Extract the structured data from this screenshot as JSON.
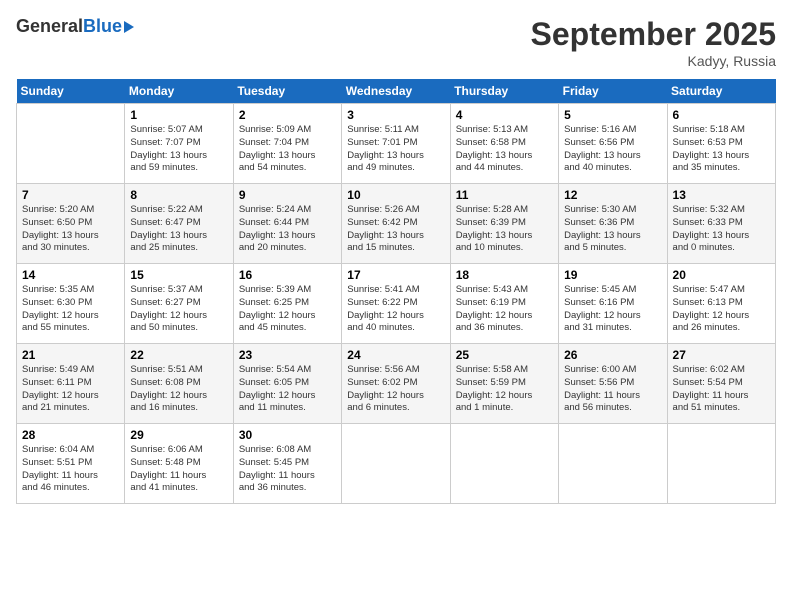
{
  "header": {
    "logo_general": "General",
    "logo_blue": "Blue",
    "month_title": "September 2025",
    "location": "Kadyy, Russia"
  },
  "weekdays": [
    "Sunday",
    "Monday",
    "Tuesday",
    "Wednesday",
    "Thursday",
    "Friday",
    "Saturday"
  ],
  "weeks": [
    [
      {
        "day": "",
        "info": ""
      },
      {
        "day": "1",
        "info": "Sunrise: 5:07 AM\nSunset: 7:07 PM\nDaylight: 13 hours\nand 59 minutes."
      },
      {
        "day": "2",
        "info": "Sunrise: 5:09 AM\nSunset: 7:04 PM\nDaylight: 13 hours\nand 54 minutes."
      },
      {
        "day": "3",
        "info": "Sunrise: 5:11 AM\nSunset: 7:01 PM\nDaylight: 13 hours\nand 49 minutes."
      },
      {
        "day": "4",
        "info": "Sunrise: 5:13 AM\nSunset: 6:58 PM\nDaylight: 13 hours\nand 44 minutes."
      },
      {
        "day": "5",
        "info": "Sunrise: 5:16 AM\nSunset: 6:56 PM\nDaylight: 13 hours\nand 40 minutes."
      },
      {
        "day": "6",
        "info": "Sunrise: 5:18 AM\nSunset: 6:53 PM\nDaylight: 13 hours\nand 35 minutes."
      }
    ],
    [
      {
        "day": "7",
        "info": "Sunrise: 5:20 AM\nSunset: 6:50 PM\nDaylight: 13 hours\nand 30 minutes."
      },
      {
        "day": "8",
        "info": "Sunrise: 5:22 AM\nSunset: 6:47 PM\nDaylight: 13 hours\nand 25 minutes."
      },
      {
        "day": "9",
        "info": "Sunrise: 5:24 AM\nSunset: 6:44 PM\nDaylight: 13 hours\nand 20 minutes."
      },
      {
        "day": "10",
        "info": "Sunrise: 5:26 AM\nSunset: 6:42 PM\nDaylight: 13 hours\nand 15 minutes."
      },
      {
        "day": "11",
        "info": "Sunrise: 5:28 AM\nSunset: 6:39 PM\nDaylight: 13 hours\nand 10 minutes."
      },
      {
        "day": "12",
        "info": "Sunrise: 5:30 AM\nSunset: 6:36 PM\nDaylight: 13 hours\nand 5 minutes."
      },
      {
        "day": "13",
        "info": "Sunrise: 5:32 AM\nSunset: 6:33 PM\nDaylight: 13 hours\nand 0 minutes."
      }
    ],
    [
      {
        "day": "14",
        "info": "Sunrise: 5:35 AM\nSunset: 6:30 PM\nDaylight: 12 hours\nand 55 minutes."
      },
      {
        "day": "15",
        "info": "Sunrise: 5:37 AM\nSunset: 6:27 PM\nDaylight: 12 hours\nand 50 minutes."
      },
      {
        "day": "16",
        "info": "Sunrise: 5:39 AM\nSunset: 6:25 PM\nDaylight: 12 hours\nand 45 minutes."
      },
      {
        "day": "17",
        "info": "Sunrise: 5:41 AM\nSunset: 6:22 PM\nDaylight: 12 hours\nand 40 minutes."
      },
      {
        "day": "18",
        "info": "Sunrise: 5:43 AM\nSunset: 6:19 PM\nDaylight: 12 hours\nand 36 minutes."
      },
      {
        "day": "19",
        "info": "Sunrise: 5:45 AM\nSunset: 6:16 PM\nDaylight: 12 hours\nand 31 minutes."
      },
      {
        "day": "20",
        "info": "Sunrise: 5:47 AM\nSunset: 6:13 PM\nDaylight: 12 hours\nand 26 minutes."
      }
    ],
    [
      {
        "day": "21",
        "info": "Sunrise: 5:49 AM\nSunset: 6:11 PM\nDaylight: 12 hours\nand 21 minutes."
      },
      {
        "day": "22",
        "info": "Sunrise: 5:51 AM\nSunset: 6:08 PM\nDaylight: 12 hours\nand 16 minutes."
      },
      {
        "day": "23",
        "info": "Sunrise: 5:54 AM\nSunset: 6:05 PM\nDaylight: 12 hours\nand 11 minutes."
      },
      {
        "day": "24",
        "info": "Sunrise: 5:56 AM\nSunset: 6:02 PM\nDaylight: 12 hours\nand 6 minutes."
      },
      {
        "day": "25",
        "info": "Sunrise: 5:58 AM\nSunset: 5:59 PM\nDaylight: 12 hours\nand 1 minute."
      },
      {
        "day": "26",
        "info": "Sunrise: 6:00 AM\nSunset: 5:56 PM\nDaylight: 11 hours\nand 56 minutes."
      },
      {
        "day": "27",
        "info": "Sunrise: 6:02 AM\nSunset: 5:54 PM\nDaylight: 11 hours\nand 51 minutes."
      }
    ],
    [
      {
        "day": "28",
        "info": "Sunrise: 6:04 AM\nSunset: 5:51 PM\nDaylight: 11 hours\nand 46 minutes."
      },
      {
        "day": "29",
        "info": "Sunrise: 6:06 AM\nSunset: 5:48 PM\nDaylight: 11 hours\nand 41 minutes."
      },
      {
        "day": "30",
        "info": "Sunrise: 6:08 AM\nSunset: 5:45 PM\nDaylight: 11 hours\nand 36 minutes."
      },
      {
        "day": "",
        "info": ""
      },
      {
        "day": "",
        "info": ""
      },
      {
        "day": "",
        "info": ""
      },
      {
        "day": "",
        "info": ""
      }
    ]
  ]
}
